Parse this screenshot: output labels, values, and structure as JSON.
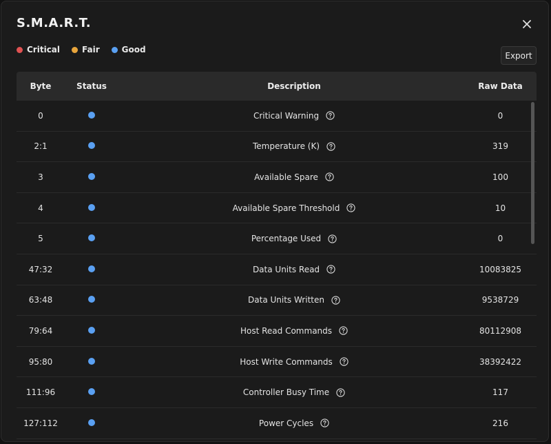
{
  "dialog": {
    "title": "S.M.A.R.T.",
    "close_icon": "close-icon",
    "export_label": "Export"
  },
  "legend": [
    {
      "label": "Critical",
      "color": "#e05252"
    },
    {
      "label": "Fair",
      "color": "#e8a53c"
    },
    {
      "label": "Good",
      "color": "#5aa0f2"
    }
  ],
  "table": {
    "headers": {
      "byte": "Byte",
      "status": "Status",
      "description": "Description",
      "raw": "Raw Data"
    },
    "rows": [
      {
        "byte": "0",
        "status": "Good",
        "description": "Critical Warning",
        "raw": "0"
      },
      {
        "byte": "2:1",
        "status": "Good",
        "description": "Temperature (K)",
        "raw": "319"
      },
      {
        "byte": "3",
        "status": "Good",
        "description": "Available Spare",
        "raw": "100"
      },
      {
        "byte": "4",
        "status": "Good",
        "description": "Available Spare Threshold",
        "raw": "10"
      },
      {
        "byte": "5",
        "status": "Good",
        "description": "Percentage Used",
        "raw": "0"
      },
      {
        "byte": "47:32",
        "status": "Good",
        "description": "Data Units Read",
        "raw": "10083825"
      },
      {
        "byte": "63:48",
        "status": "Good",
        "description": "Data Units Written",
        "raw": "9538729"
      },
      {
        "byte": "79:64",
        "status": "Good",
        "description": "Host Read Commands",
        "raw": "80112908"
      },
      {
        "byte": "95:80",
        "status": "Good",
        "description": "Host Write Commands",
        "raw": "38392422"
      },
      {
        "byte": "111:96",
        "status": "Good",
        "description": "Controller Busy Time",
        "raw": "117"
      },
      {
        "byte": "127:112",
        "status": "Good",
        "description": "Power Cycles",
        "raw": "216"
      }
    ]
  }
}
